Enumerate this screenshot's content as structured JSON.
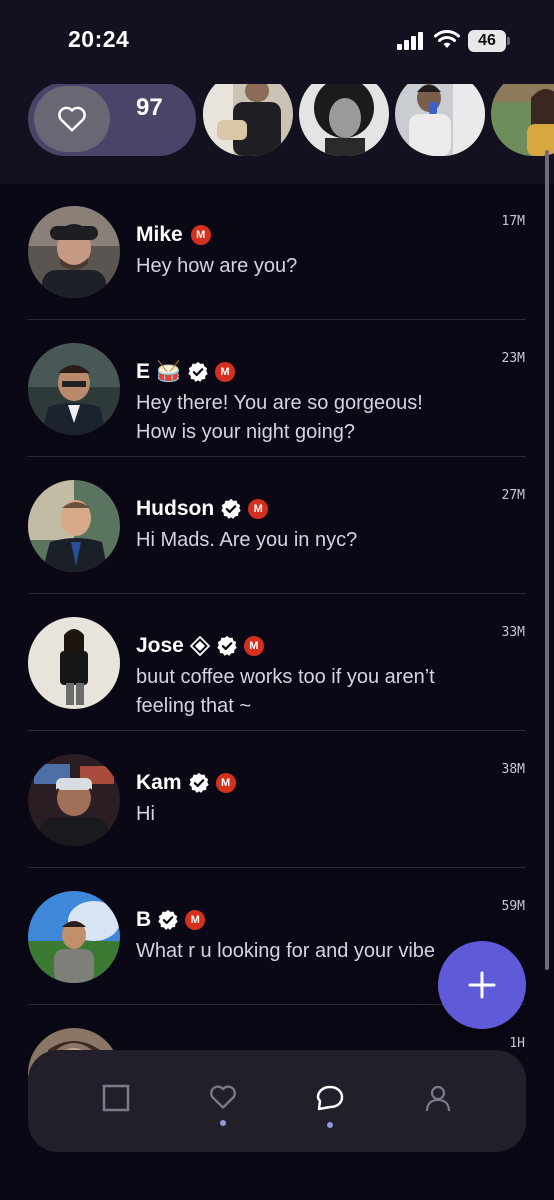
{
  "status_bar": {
    "time": "20:24",
    "battery": "46"
  },
  "likes": {
    "count": "97"
  },
  "stories": [
    {
      "name": "story-1"
    },
    {
      "name": "story-2"
    },
    {
      "name": "story-3"
    },
    {
      "name": "story-4"
    }
  ],
  "conversations": [
    {
      "name": "Mike",
      "emoji": "",
      "verified": false,
      "diamond": false,
      "message": "Hey how are you?",
      "time": "17M"
    },
    {
      "name": "E",
      "emoji": "🥁",
      "verified": true,
      "diamond": false,
      "message": "Hey there! You are so gorgeous!\nHow is your night going?",
      "time": "23M"
    },
    {
      "name": "Hudson",
      "emoji": "",
      "verified": true,
      "diamond": false,
      "message": "Hi Mads. Are you in nyc?",
      "time": "27M"
    },
    {
      "name": "Jose",
      "emoji": "",
      "verified": true,
      "diamond": true,
      "message": "buut coffee works too if you aren’t\nfeeling that ~",
      "time": "33M"
    },
    {
      "name": "Kam",
      "emoji": "",
      "verified": true,
      "diamond": false,
      "message": "Hi",
      "time": "38M"
    },
    {
      "name": "B",
      "emoji": "",
      "verified": true,
      "diamond": false,
      "message": "What r u looking for and your vibe",
      "time": "59M"
    },
    {
      "name": "",
      "emoji": "",
      "verified": false,
      "diamond": false,
      "message": "",
      "time": "1H"
    }
  ],
  "badges": {
    "m_label": "M"
  },
  "colors": {
    "accent": "#5f5bd8",
    "background": "#0b0816",
    "badge_red": "#d52f1e",
    "likes_pill": "#4a4468"
  },
  "tab_bar": {
    "tabs": [
      {
        "icon": "square-icon",
        "active": false,
        "dot": false
      },
      {
        "icon": "heart-icon",
        "active": false,
        "dot": true
      },
      {
        "icon": "chat-bubble-icon",
        "active": true,
        "dot": true
      },
      {
        "icon": "profile-icon",
        "active": false,
        "dot": false
      }
    ]
  }
}
